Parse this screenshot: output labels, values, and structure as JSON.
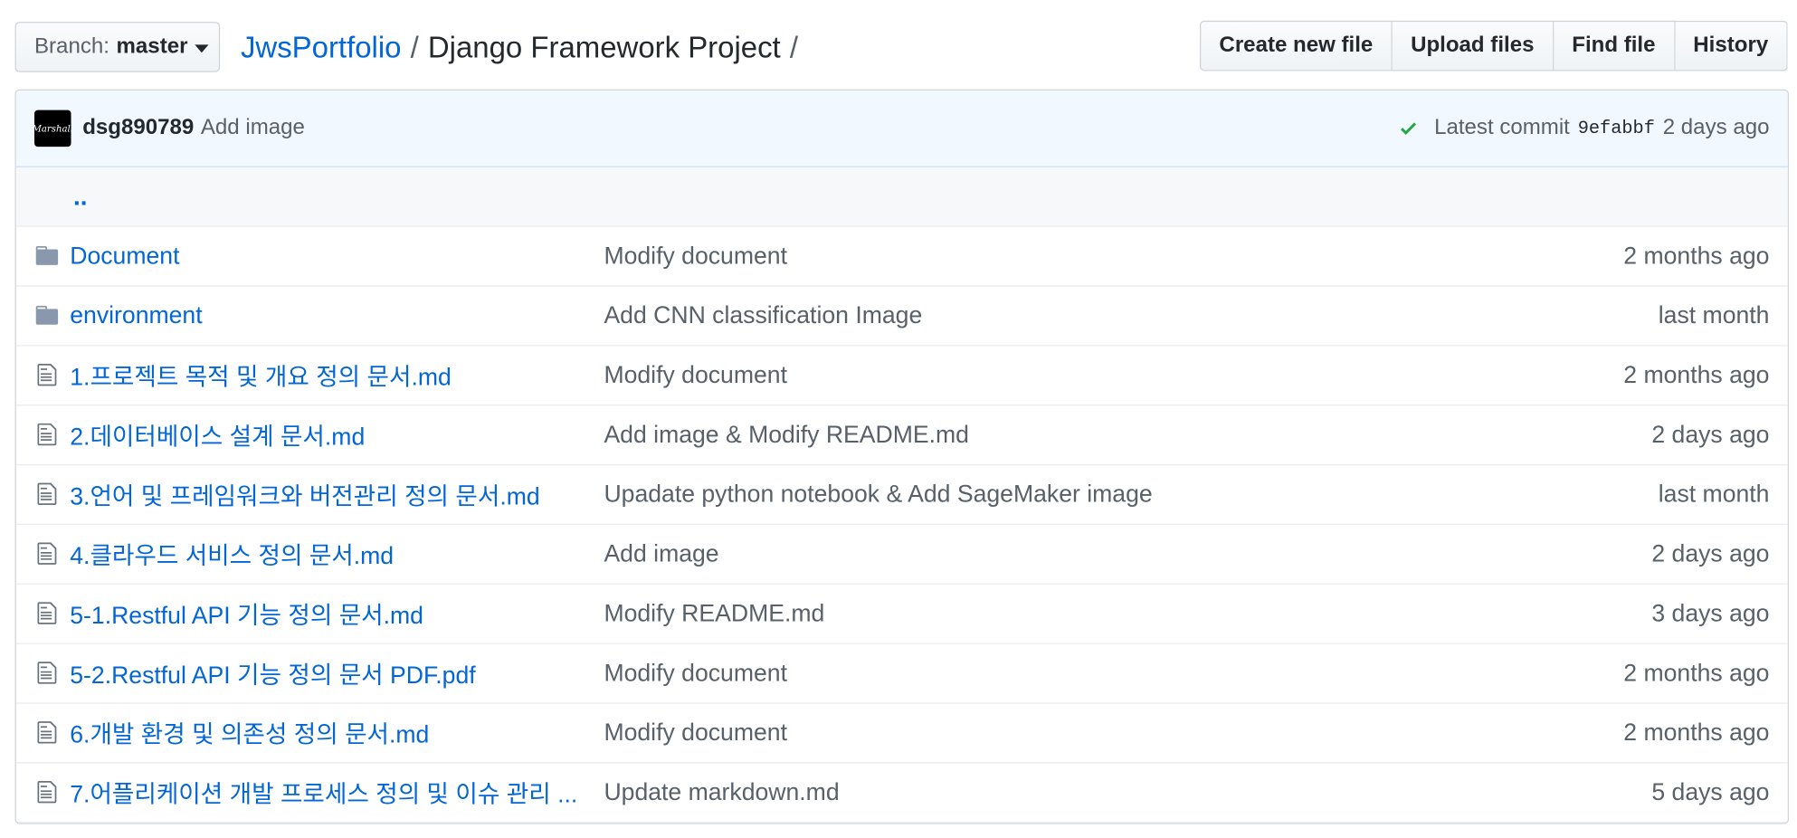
{
  "branch": {
    "prefix": "Branch:",
    "name": "master"
  },
  "breadcrumb": {
    "repo": "JwsPortfolio",
    "sep1": "/",
    "path": "Django Framework Project",
    "sep2": "/"
  },
  "actions": {
    "create": "Create new file",
    "upload": "Upload files",
    "find": "Find file",
    "history": "History"
  },
  "commit": {
    "avatar_text": "Marshall",
    "author": "dsg890789",
    "message": "Add image",
    "latest_label": "Latest commit",
    "sha": "9efabbf",
    "age": "2 days ago",
    "status_color": "#28a745"
  },
  "parent_link": "..",
  "files": [
    {
      "type": "folder",
      "name": "Document",
      "message": "Modify document",
      "age": "2 months ago"
    },
    {
      "type": "folder",
      "name": "environment",
      "message": "Add CNN classification Image",
      "age": "last month"
    },
    {
      "type": "file",
      "name": "1.프로젝트 목적 및 개요 정의 문서.md",
      "message": "Modify document",
      "age": "2 months ago"
    },
    {
      "type": "file",
      "name": "2.데이터베이스 설계 문서.md",
      "message": "Add image & Modify README.md",
      "age": "2 days ago"
    },
    {
      "type": "file",
      "name": "3.언어 및 프레임워크와 버전관리 정의 문서.md",
      "message": "Upadate python notebook & Add SageMaker image",
      "age": "last month"
    },
    {
      "type": "file",
      "name": "4.클라우드 서비스 정의 문서.md",
      "message": "Add image",
      "age": "2 days ago"
    },
    {
      "type": "file",
      "name": "5-1.Restful API 기능 정의 문서.md",
      "message": "Modify README.md",
      "age": "3 days ago"
    },
    {
      "type": "file",
      "name": "5-2.Restful API 기능 정의 문서 PDF.pdf",
      "message": "Modify document",
      "age": "2 months ago"
    },
    {
      "type": "file",
      "name": "6.개발 환경 및 의존성 정의 문서.md",
      "message": "Modify document",
      "age": "2 months ago"
    },
    {
      "type": "file",
      "name": "7.어플리케이션 개발 프로세스 정의 및 이슈 관리 ...",
      "message": "Update markdown.md",
      "age": "5 days ago"
    }
  ],
  "colors": {
    "link": "#0366d6",
    "folder": "#8a98ad",
    "muted": "#586069"
  }
}
